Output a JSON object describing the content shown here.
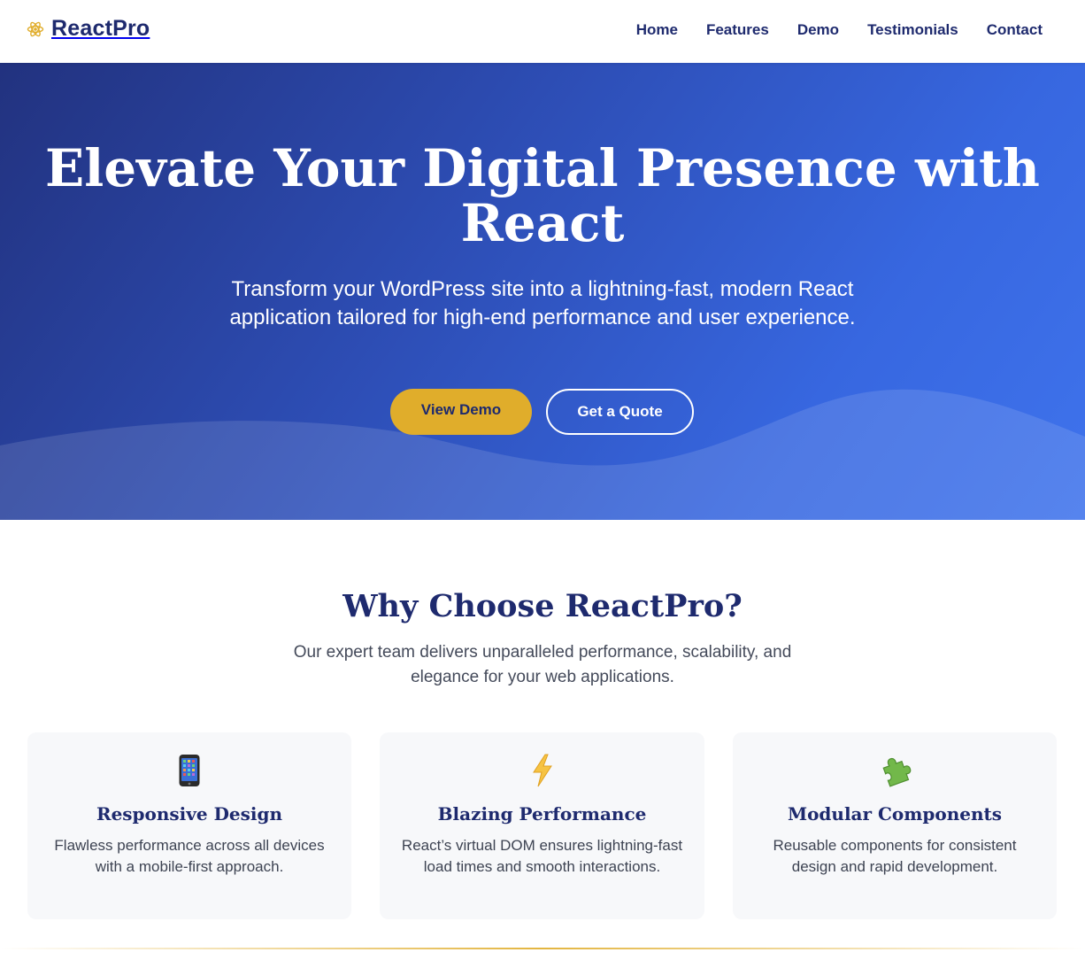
{
  "header": {
    "brand": "ReactPro",
    "nav": [
      "Home",
      "Features",
      "Demo",
      "Testimonials",
      "Contact"
    ]
  },
  "hero": {
    "title_line1": "Elevate Your Digital Presence with",
    "title_line2": "React",
    "subtitle": "Transform your WordPress site into a lightning-fast, modern React application tailored for high-end performance and user experience.",
    "primary_button": "View Demo",
    "secondary_button": "Get a Quote"
  },
  "why": {
    "title": "Why Choose ReactPro?",
    "subtitle": "Our expert team delivers unparalleled performance, scalability, and elegance for your web applications."
  },
  "features": [
    {
      "icon": "mobile-phone-icon",
      "title": "Responsive Design",
      "description": "Flawless performance across all devices with a mobile-first approach."
    },
    {
      "icon": "lightning-icon",
      "title": "Blazing Performance",
      "description": "React’s virtual DOM ensures lightning-fast load times and smooth interactions."
    },
    {
      "icon": "puzzle-piece-icon",
      "title": "Modular Components",
      "description": "Reusable components for consistent design and rapid development."
    }
  ],
  "colors": {
    "navy": "#1e2a6e",
    "gold": "#e0ad2b",
    "hero_start": "#22327f",
    "hero_end": "#3f73ec"
  }
}
